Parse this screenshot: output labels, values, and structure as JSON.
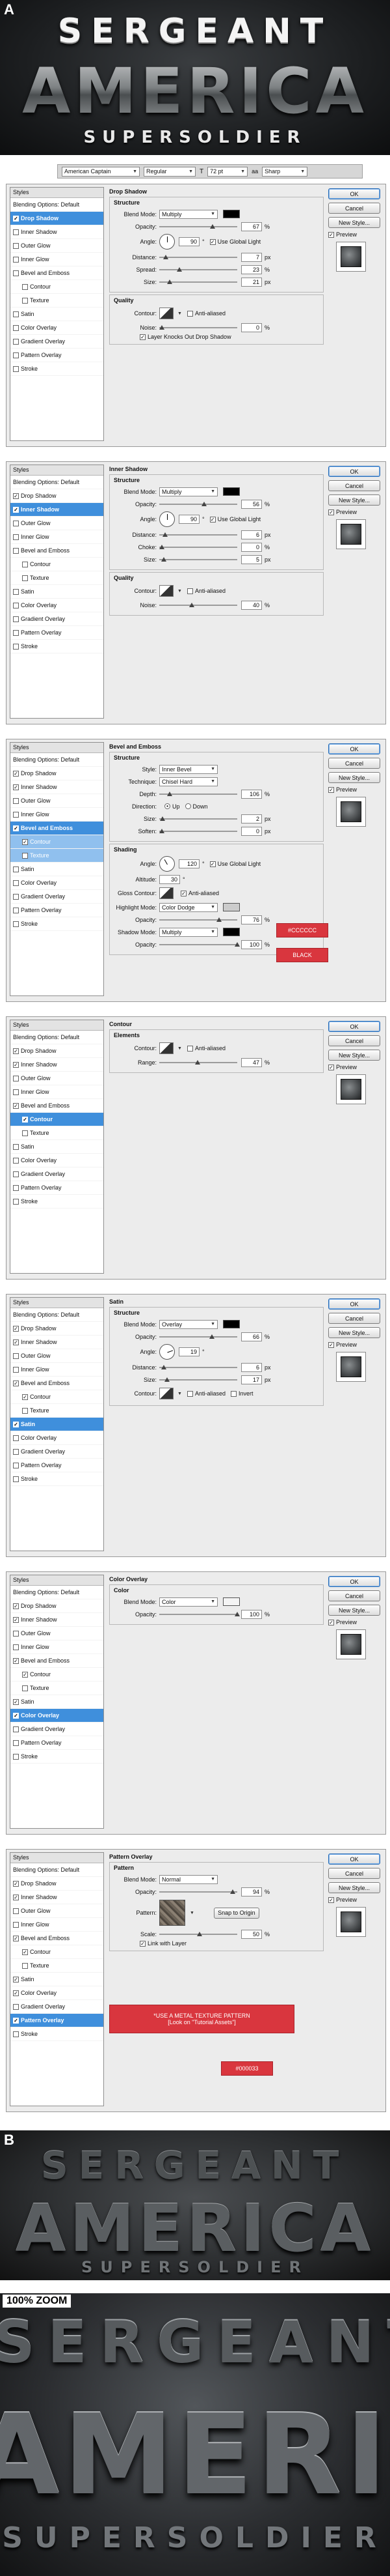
{
  "section_a": {
    "letter": "A",
    "title_line1": "SERGEANT",
    "title_line2": "AMERICA",
    "title_line3": "SUPERSOLDIER",
    "options_bar": {
      "font_family": "American Captain",
      "font_style": "Regular",
      "font_size": "72 pt",
      "anti_alias": "Sharp"
    }
  },
  "common": {
    "styles_header": "Styles",
    "blending_options": "Blending Options: Default",
    "style_items": [
      "Drop Shadow",
      "Inner Shadow",
      "Outer Glow",
      "Inner Glow",
      "Bevel and Emboss",
      "Contour",
      "Texture",
      "Satin",
      "Color Overlay",
      "Gradient Overlay",
      "Pattern Overlay",
      "Stroke"
    ],
    "buttons": {
      "ok": "OK",
      "cancel": "Cancel",
      "new_style": "New Style...",
      "preview": "Preview"
    }
  },
  "panels": {
    "drop_shadow": {
      "title": "Drop Shadow",
      "structure": "Structure",
      "blend_mode_label": "Blend Mode:",
      "blend_mode": "Multiply",
      "color": "#000000",
      "opacity_label": "Opacity:",
      "opacity": "67",
      "angle_label": "Angle:",
      "angle": "90",
      "use_global_light": "Use Global Light",
      "distance_label": "Distance:",
      "distance": "7",
      "spread_label": "Spread:",
      "spread": "23",
      "size_label": "Size:",
      "size": "21",
      "quality": "Quality",
      "contour_label": "Contour:",
      "anti_aliased": "Anti-aliased",
      "noise_label": "Noise:",
      "noise": "0",
      "knockout": "Layer Knocks Out Drop Shadow"
    },
    "inner_shadow": {
      "title": "Inner Shadow",
      "structure": "Structure",
      "blend_mode_label": "Blend Mode:",
      "blend_mode": "Multiply",
      "color": "#000000",
      "opacity_label": "Opacity:",
      "opacity": "56",
      "angle_label": "Angle:",
      "angle": "90",
      "use_global_light": "Use Global Light",
      "distance_label": "Distance:",
      "distance": "6",
      "choke_label": "Choke:",
      "choke": "0",
      "size_label": "Size:",
      "size": "5",
      "quality": "Quality",
      "contour_label": "Contour:",
      "anti_aliased": "Anti-aliased",
      "noise_label": "Noise:",
      "noise": "40"
    },
    "bevel": {
      "title": "Bevel and Emboss",
      "structure": "Structure",
      "style_label": "Style:",
      "style": "Inner Bevel",
      "technique_label": "Technique:",
      "technique": "Chisel Hard",
      "depth_label": "Depth:",
      "depth": "106",
      "direction_label": "Direction:",
      "up": "Up",
      "down": "Down",
      "size_label": "Size:",
      "size": "2",
      "soften_label": "Soften:",
      "soften": "0",
      "shading": "Shading",
      "angle_label": "Angle:",
      "angle": "120",
      "use_global_light": "Use Global Light",
      "altitude_label": "Altitude:",
      "altitude": "30",
      "gloss_label": "Gloss Contour:",
      "anti_aliased": "Anti-aliased",
      "highlight_label": "Highlight Mode:",
      "highlight_mode": "Color Dodge",
      "highlight_opacity": "76",
      "shadow_label": "Shadow Mode:",
      "shadow_mode": "Multiply",
      "shadow_opacity": "100",
      "opacity_label": "Opacity:",
      "note_highlight": "#CCCCCC",
      "note_shadow": "BLACK"
    },
    "contour": {
      "title": "Contour",
      "elements": "Elements",
      "contour_label": "Contour:",
      "anti_aliased": "Anti-aliased",
      "range_label": "Range:",
      "range": "47"
    },
    "satin": {
      "title": "Satin",
      "structure": "Structure",
      "blend_mode_label": "Blend Mode:",
      "blend_mode": "Overlay",
      "color": "#000000",
      "opacity_label": "Opacity:",
      "opacity": "66",
      "angle_label": "Angle:",
      "angle": "19",
      "distance_label": "Distance:",
      "distance": "6",
      "size_label": "Size:",
      "size": "17",
      "contour_label": "Contour:",
      "anti_aliased": "Anti-aliased",
      "invert": "Invert"
    },
    "color_overlay": {
      "title": "Color Overlay",
      "color_heading": "Color",
      "blend_mode_label": "Blend Mode:",
      "blend_mode": "Color",
      "color": "#f4f4f4",
      "opacity_label": "Opacity:",
      "opacity": "100"
    },
    "pattern_overlay": {
      "title": "Pattern Overlay",
      "patterns": "Pattern",
      "blend_mode_label": "Blend Mode:",
      "blend_mode": "Normal",
      "opacity_label": "Opacity:",
      "opacity": "94",
      "pattern_label": "Pattern:",
      "snap": "Snap to Origin",
      "scale_label": "Scale:",
      "scale": "50",
      "link": "Link with Layer",
      "note_pattern_1": "*USE A METAL TEXTURE PATTERN",
      "note_pattern_2": "[Look on \"Tutorial Assets\"]",
      "note_color": "#000033"
    }
  },
  "section_b": {
    "letter": "B",
    "title_line1": "SERGEANT",
    "title_line2": "AMERICA",
    "title_line3": "SUPERSOLDIER"
  },
  "zoom": {
    "label": "100% ZOOM",
    "title_line1": "SERGEANT",
    "title_line2": "AMERICA",
    "title_line3": "SUPERSOLDIER"
  }
}
